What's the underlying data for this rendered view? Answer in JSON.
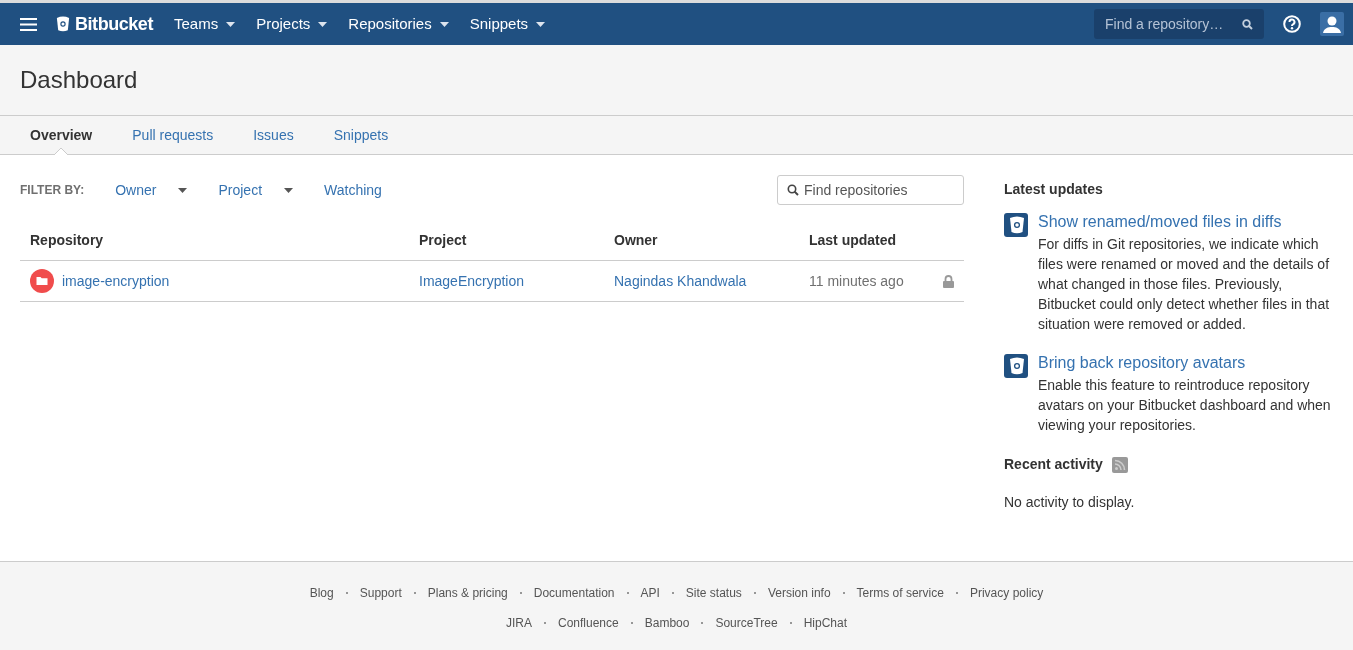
{
  "topbar": {
    "logo": "Bitbucket",
    "menus": [
      {
        "label": "Teams"
      },
      {
        "label": "Projects"
      },
      {
        "label": "Repositories"
      },
      {
        "label": "Snippets"
      }
    ],
    "search": {
      "placeholder": "Find a repository…"
    }
  },
  "page_title": "Dashboard",
  "tabs": [
    {
      "label": "Overview",
      "selected": true
    },
    {
      "label": "Pull requests",
      "selected": false
    },
    {
      "label": "Issues",
      "selected": false
    },
    {
      "label": "Snippets",
      "selected": false
    }
  ],
  "filter": {
    "label": "FILTER BY:",
    "options": [
      {
        "label": "Owner",
        "dropdown": true
      },
      {
        "label": "Project",
        "dropdown": true
      },
      {
        "label": "Watching",
        "dropdown": false
      }
    ],
    "search": {
      "placeholder": "Find repositories"
    }
  },
  "table": {
    "columns": [
      "Repository",
      "Project",
      "Owner",
      "Last updated"
    ],
    "rows": [
      {
        "repository": "image-encryption",
        "project": "ImageEncryption",
        "owner": "Nagindas Khandwala",
        "last_updated": "11 minutes ago",
        "private": true
      }
    ]
  },
  "latest_updates": {
    "title": "Latest updates",
    "items": [
      {
        "title": "Show renamed/moved files in diffs",
        "body": "For diffs in Git repositories, we indicate which files were renamed or moved and the details of what changed in those files. Previously, Bitbucket could only detect whether files in that situation were removed or added."
      },
      {
        "title": "Bring back repository avatars",
        "body": "Enable this feature to reintroduce repository avatars on your Bitbucket dashboard and when viewing your repositories."
      }
    ]
  },
  "recent_activity": {
    "title": "Recent activity",
    "empty": "No activity to display."
  },
  "footer": {
    "site_links": [
      "Blog",
      "Support",
      "Plans & pricing",
      "Documentation",
      "API",
      "Site status",
      "Version info",
      "Terms of service",
      "Privacy policy"
    ],
    "product_links": [
      "JIRA",
      "Confluence",
      "Bamboo",
      "SourceTree",
      "HipChat"
    ]
  }
}
